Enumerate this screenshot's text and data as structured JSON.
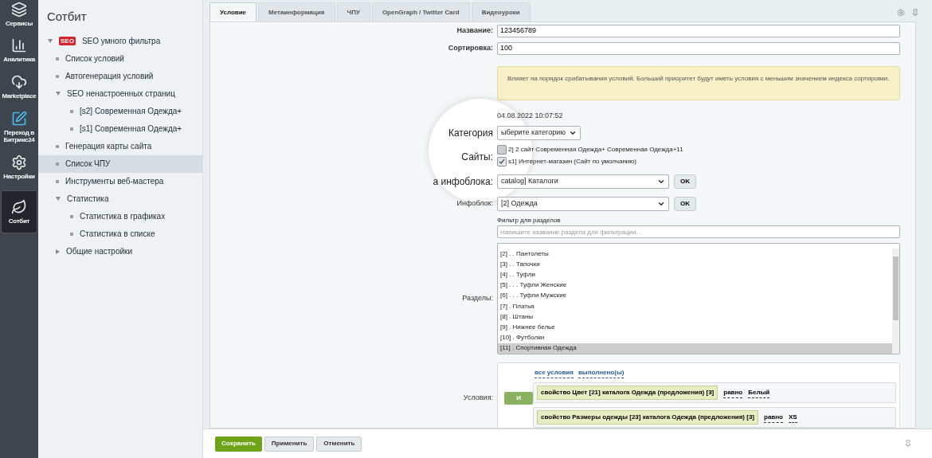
{
  "rail": [
    {
      "label": "Сервисы",
      "selected": false
    },
    {
      "label": "Аналитика",
      "selected": false
    },
    {
      "label": "Marketplace",
      "selected": false
    },
    {
      "label": "Переход в Битрикс24",
      "selected": false
    },
    {
      "label": "Настройки",
      "selected": false
    },
    {
      "label": "Сотбит",
      "selected": true
    }
  ],
  "sidebar": {
    "title": "Сотбит",
    "items": [
      {
        "label": "SEO умного фильтра",
        "kind": "folder",
        "expanded": true,
        "badge": "SEO",
        "selected": false,
        "children": [
          {
            "label": "Список условий",
            "kind": "page",
            "selected": false
          },
          {
            "label": "Автогенерация условий",
            "kind": "page",
            "selected": false
          },
          {
            "label": "SEO ненастроенных страниц",
            "kind": "folder",
            "expanded": true,
            "selected": false,
            "children": [
              {
                "label": "[s2] Современная Одежда+",
                "kind": "page",
                "selected": false
              },
              {
                "label": "[s1] Современная Одежда+",
                "kind": "page",
                "selected": false
              }
            ]
          },
          {
            "label": "Генерация карты сайта",
            "kind": "page",
            "selected": false
          },
          {
            "label": "Список ЧПУ",
            "kind": "page",
            "selected": true
          },
          {
            "label": "Инструменты веб-мастера",
            "kind": "page",
            "selected": false
          },
          {
            "label": "Статистика",
            "kind": "folder",
            "expanded": true,
            "selected": false,
            "children": [
              {
                "label": "Статистика в графиках",
                "kind": "page",
                "selected": false
              },
              {
                "label": "Статистика в списке",
                "kind": "page",
                "selected": false
              }
            ]
          },
          {
            "label": "Общие настройки",
            "kind": "folder",
            "expanded": false,
            "selected": false
          }
        ]
      }
    ]
  },
  "tabs": [
    {
      "label": "Условие",
      "selected": true
    },
    {
      "label": "Метаинформация",
      "selected": false
    },
    {
      "label": "ЧПУ",
      "selected": false
    },
    {
      "label": "OpenGraph / Twitter Card",
      "selected": false
    },
    {
      "label": "Видеоуроки",
      "selected": false
    }
  ],
  "form": {
    "name": {
      "label": "Название:",
      "value": "123456789"
    },
    "sort": {
      "label": "Сортировка:",
      "value": "100"
    },
    "note": "Влияет на порядок срабатывания условий. Больший приоритет будут иметь условия с меньшим значением индекса сортировки.",
    "date": {
      "value": "04.08.2022 10:07:52"
    },
    "category": {
      "label": "Категория",
      "value": "ыберите категорию"
    },
    "sites": {
      "label": "Сайты:",
      "options": [
        {
          "label": "2] 2 сайт Современная Одежда+ Современная Одежда+11",
          "checked": false
        },
        {
          "label": "s1] Интернет-магазин (Сайт по умолчанию)",
          "checked": true
        }
      ]
    },
    "iblock_type": {
      "label": "а инфоблока:",
      "value": "catalog] Каталоги",
      "button": "OK"
    },
    "iblock": {
      "label": "Инфоблок:",
      "value": "[2] Одежда",
      "button": "OK"
    },
    "section_filter": {
      "label": "Фильтр для разделов",
      "placeholder": "Напишите название раздела для фильтрации..."
    },
    "sections": {
      "label": "Разделы:",
      "items": [
        {
          "label": "[2] . . Пантолеты",
          "selected": false
        },
        {
          "label": "[3] . . Тапочки",
          "selected": false
        },
        {
          "label": "[4] . . Туфли",
          "selected": false
        },
        {
          "label": "[5] . . . Туфли Женские",
          "selected": false
        },
        {
          "label": "[6] . . . Туфли Мужские",
          "selected": false
        },
        {
          "label": "[7] . Платья",
          "selected": false
        },
        {
          "label": "[8] . Штаны",
          "selected": false
        },
        {
          "label": "[9] . Нижнее белье",
          "selected": false
        },
        {
          "label": "[10] . Футболки",
          "selected": false
        },
        {
          "label": "[11] . Спортивная Одежда",
          "selected": true
        }
      ]
    },
    "conditions": {
      "label": "Условия:",
      "links": [
        "все условия",
        "выполнено(ы)"
      ],
      "operator": "И",
      "rules": [
        {
          "property": "свойство Цвет [21] каталога Одежда (предложения) [3]",
          "compare": "равно",
          "value": "Белый"
        },
        {
          "property": "свойство Размеры одежды [23] каталога Одежда (предложения) [3]",
          "compare": "равно",
          "value": "XS"
        }
      ]
    }
  },
  "footer": {
    "buttons": [
      {
        "label": "Сохранить",
        "kind": "primary"
      },
      {
        "label": "Применить",
        "kind": "plain"
      },
      {
        "label": "Отменить",
        "kind": "plain"
      }
    ]
  }
}
